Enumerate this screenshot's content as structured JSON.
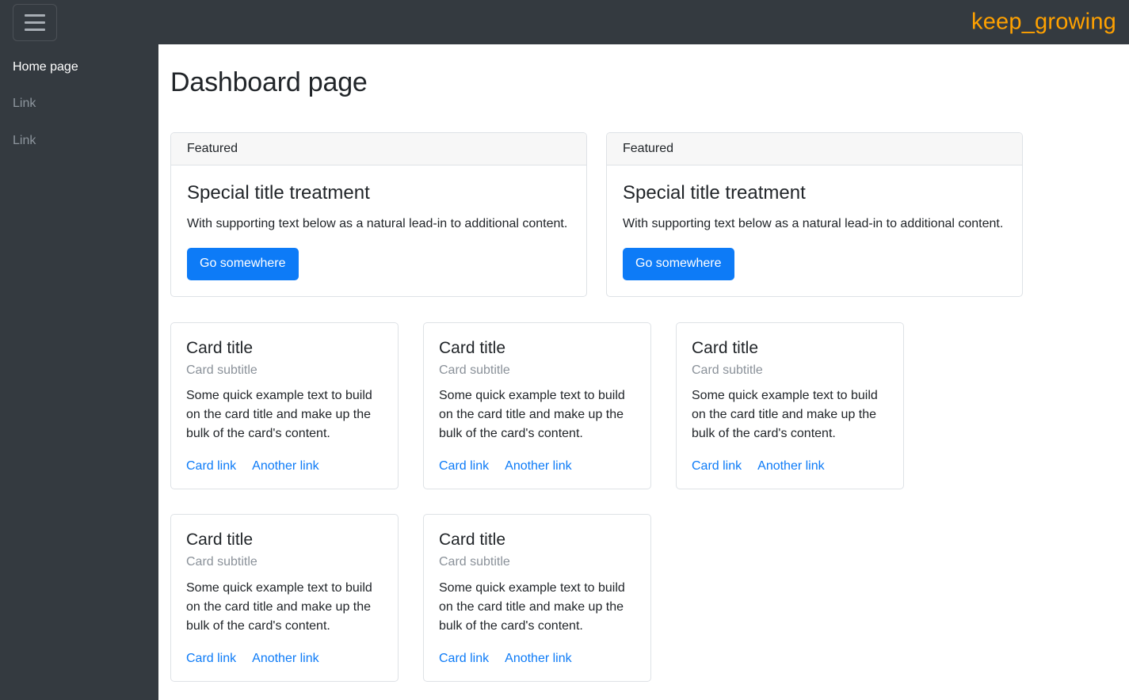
{
  "topbar": {
    "menu_toggle_label": "Toggle navigation",
    "brand": "keep_growing",
    "brand_color": "#ffa100",
    "background_color": "#343a40"
  },
  "sidebar": {
    "background_color": "#343a40",
    "items": [
      {
        "label": "Home page",
        "active": true
      },
      {
        "label": "Link",
        "active": false
      },
      {
        "label": "Link",
        "active": false
      }
    ]
  },
  "main": {
    "page_title": "Dashboard page",
    "featured_cards": [
      {
        "header": "Featured",
        "title": "Special title treatment",
        "text": "With supporting text below as a natural lead-in to additional content.",
        "button_label": "Go somewhere"
      },
      {
        "header": "Featured",
        "title": "Special title treatment",
        "text": "With supporting text below as a natural lead-in to additional content.",
        "button_label": "Go somewhere"
      }
    ],
    "cards": [
      {
        "title": "Card title",
        "subtitle": "Card subtitle",
        "text": "Some quick example text to build on the card title and make up the bulk of the card's content.",
        "link1": "Card link",
        "link2": "Another link"
      },
      {
        "title": "Card title",
        "subtitle": "Card subtitle",
        "text": "Some quick example text to build on the card title and make up the bulk of the card's content.",
        "link1": "Card link",
        "link2": "Another link"
      },
      {
        "title": "Card title",
        "subtitle": "Card subtitle",
        "text": "Some quick example text to build on the card title and make up the bulk of the card's content.",
        "link1": "Card link",
        "link2": "Another link"
      },
      {
        "title": "Card title",
        "subtitle": "Card subtitle",
        "text": "Some quick example text to build on the card title and make up the bulk of the card's content.",
        "link1": "Card link",
        "link2": "Another link"
      },
      {
        "title": "Card title",
        "subtitle": "Card subtitle",
        "text": "Some quick example text to build on the card title and make up the bulk of the card's content.",
        "link1": "Card link",
        "link2": "Another link"
      }
    ]
  },
  "theme": {
    "primary_button_color": "#0d7bf7",
    "link_color": "#0d7bf7",
    "card_border_color": "#dee2e6",
    "card_header_bg": "#f7f7f7",
    "muted_text_color": "#8a9199"
  }
}
